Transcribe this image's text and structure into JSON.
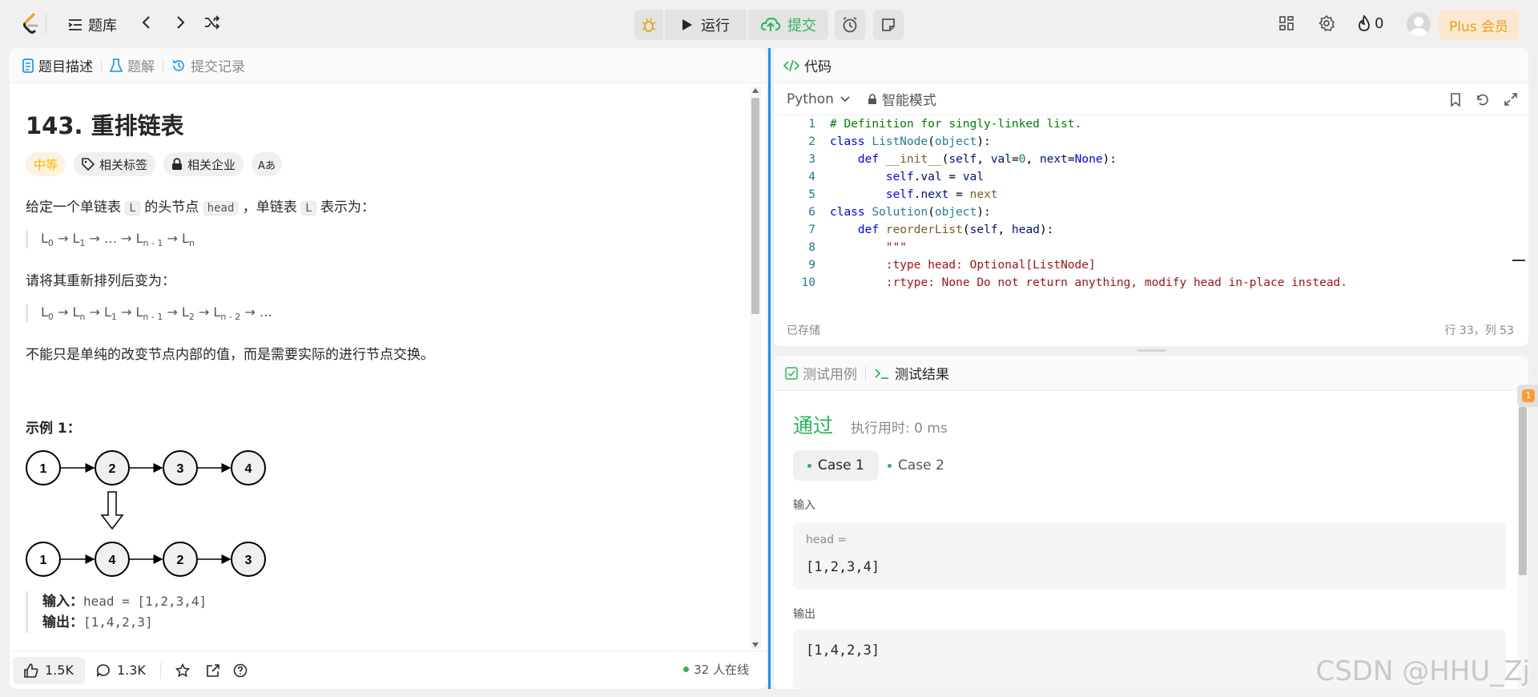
{
  "topbar": {
    "problem_bank": "题库",
    "run_label": "运行",
    "submit_label": "提交",
    "streak_count": "0",
    "plus_label": "Plus 会员"
  },
  "left_panel": {
    "tabs": [
      "题目描述",
      "题解",
      "提交记录"
    ],
    "title": "143. 重排链表",
    "tags": {
      "difficulty": "中等",
      "related_tags": "相关标签",
      "related_companies": "相关企业",
      "font_icon": "Aあ"
    },
    "desc1_a": "给定一个单链表 ",
    "desc1_code1": "L",
    "desc1_b": " 的头节点 ",
    "desc1_code2": "head",
    "desc1_c": " ，单链表 ",
    "desc1_code3": "L",
    "desc1_d": " 表示为：",
    "desc2": "请将其重新排列后变为：",
    "desc3": "不能只是单纯的改变节点内部的值，而是需要实际的进行节点交换。",
    "example_title": "示例 1：",
    "example_input_label": "输入：",
    "example_input": "head = [1,2,3,4]",
    "example_output_label": "输出：",
    "example_output": "[1,4,2,3]",
    "diagram_top": [
      "1",
      "2",
      "3",
      "4"
    ],
    "diagram_bottom": [
      "1",
      "4",
      "2",
      "3"
    ],
    "footer": {
      "likes": "1.5K",
      "comments": "1.3K",
      "online": "32 人在线"
    }
  },
  "code_panel": {
    "title": "代码",
    "language": "Python",
    "mode": "智能模式",
    "status": "已存储",
    "cursor": "行 33，列 53"
  },
  "result_panel": {
    "tabs": [
      "测试用例",
      "测试结果"
    ],
    "verdict": "通过",
    "runtime": "执行用时: 0 ms",
    "cases": [
      "Case 1",
      "Case 2"
    ],
    "input_label": "输入",
    "input_var": "head =",
    "input_value": "[1,2,3,4]",
    "output_label": "输出",
    "output_value": "[1,4,2,3]",
    "notification_count": "1"
  },
  "watermark": "CSDN @HHU_Zj",
  "colors": {
    "accent_blue": "#1a90ff",
    "pass_green": "#2db55d",
    "difficulty_orange": "#ffb800",
    "plus_gold": "#e8a317"
  }
}
